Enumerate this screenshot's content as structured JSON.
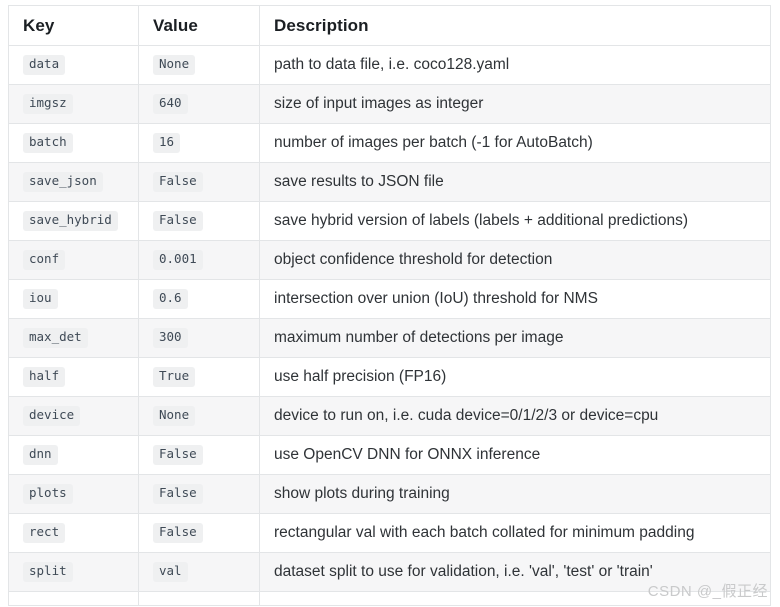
{
  "table": {
    "columns": [
      "Key",
      "Value",
      "Description"
    ],
    "rows": [
      {
        "key": "data",
        "value": "None",
        "description": "path to data file, i.e. coco128.yaml"
      },
      {
        "key": "imgsz",
        "value": "640",
        "description": "size of input images as integer"
      },
      {
        "key": "batch",
        "value": "16",
        "description": "number of images per batch (-1 for AutoBatch)"
      },
      {
        "key": "save_json",
        "value": "False",
        "description": "save results to JSON file"
      },
      {
        "key": "save_hybrid",
        "value": "False",
        "description": "save hybrid version of labels (labels + additional predictions)"
      },
      {
        "key": "conf",
        "value": "0.001",
        "description": "object confidence threshold for detection"
      },
      {
        "key": "iou",
        "value": "0.6",
        "description": "intersection over union (IoU) threshold for NMS"
      },
      {
        "key": "max_det",
        "value": "300",
        "description": "maximum number of detections per image"
      },
      {
        "key": "half",
        "value": "True",
        "description": "use half precision (FP16)"
      },
      {
        "key": "device",
        "value": "None",
        "description": "device to run on, i.e. cuda device=0/1/2/3 or device=cpu"
      },
      {
        "key": "dnn",
        "value": "False",
        "description": "use OpenCV DNN for ONNX inference"
      },
      {
        "key": "plots",
        "value": "False",
        "description": "show plots during training"
      },
      {
        "key": "rect",
        "value": "False",
        "description": "rectangular val with each batch collated for minimum padding"
      },
      {
        "key": "split",
        "value": "val",
        "description": "dataset split to use for validation, i.e. 'val', 'test' or 'train'"
      }
    ]
  },
  "watermark": {
    "text": "CSDN @_假正经"
  },
  "colors": {
    "border": "#e3e5e7",
    "stripe": "#f6f6f7",
    "chip_bg": "#eff0f1",
    "chip_text": "#3f4a56",
    "desc_text": "#2f3337",
    "header_text": "#1b1f23",
    "watermark": "#c9cacb"
  }
}
